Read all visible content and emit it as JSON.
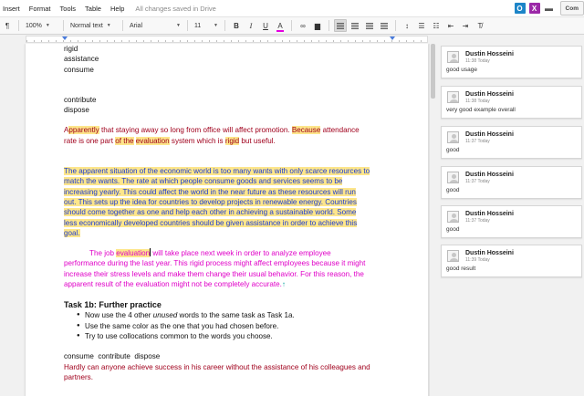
{
  "menu": {
    "items": [
      "Insert",
      "Format",
      "Tools",
      "Table",
      "Help"
    ],
    "saved_status": "All changes saved in Drive",
    "comments_button": "Com"
  },
  "toolbar": {
    "zoom": "100%",
    "style": "Normal text",
    "font": "Arial",
    "size": "11",
    "bold": "B",
    "italic": "I",
    "underline": "U",
    "text_color": "A",
    "text_color_swatch": "#e400e0"
  },
  "document": {
    "word_list_a": [
      "rigid",
      "assistance",
      "consume"
    ],
    "word_list_b": [
      "contribute",
      "dispose"
    ],
    "para1": {
      "s1_pre": "A",
      "s1_hl": "pparently",
      "s1_post": " that staying away so long from office will affect promotion. ",
      "s2_hl": "Because",
      "s2_post": " attendance",
      "s3_pre": "rate is one part ",
      "s3_of": "of the",
      "s3_sp": " ",
      "s3_hl": "evaluation",
      "s3_mid": " system which is ",
      "s3_rigid": "rigid",
      "s3_post": " but useful."
    },
    "para2_lines": [
      "The apparent situation of the economic world is too many wants with only scarce resources to",
      "match the wants. The rate at which people consume goods and services seems to be",
      "increasing yearly. This could affect the world in the near future as these resources will run",
      "out. This sets up the idea for countries to develop projects in renewable energy. Countries",
      "should come together as one and help each other in achieving a sustainable world. Some",
      "less economically developed countries should be given assistance in order to achieve this",
      "goal."
    ],
    "para3": {
      "l1_pre": "The job ",
      "l1_hl": "evaluation",
      "l1_post": " will take place next week in order to analyze employee",
      "lines": [
        "performance during the last year. This rigid process might affect employees because it might",
        "increase their stress levels and make them change their usual behavior. For this reason, the"
      ],
      "l4": "apparent result of the evaluation might not be completely accurate.",
      "caret_mark": "↑"
    },
    "task": {
      "heading": "Task 1b: Further practice",
      "bullet1_pre": "Now use the 4 other ",
      "bullet1_em": "unused",
      "bullet1_post": " words to the same task as Task 1a.",
      "bullet2": "Use the same color as the one that you had chosen before.",
      "bullet3": "Try to use collocations common to the words you choose."
    },
    "footer_words": "consume  contribute  dispose",
    "footer_lines": [
      "Hardly can anyone achieve success in his career without the assistance of his colleagues and",
      "partners."
    ]
  },
  "comments": [
    {
      "author": "Dustin Hosseini",
      "time": "11:38 Today",
      "text": "good usage"
    },
    {
      "author": "Dustin Hosseini",
      "time": "11:38 Today",
      "text": "very good example overall"
    },
    {
      "author": "Dustin Hosseini",
      "time": "11:37 Today",
      "text": "good"
    },
    {
      "author": "Dustin Hosseini",
      "time": "11:37 Today",
      "text": "good"
    },
    {
      "author": "Dustin Hosseini",
      "time": "11:37 Today",
      "text": "good"
    },
    {
      "author": "Dustin Hosseini",
      "time": "11:39 Today",
      "text": "good result"
    }
  ],
  "colors": {
    "highlight": "#fde68b",
    "red_text": "#a0001c",
    "blue_text": "#1b3bd2",
    "magenta_text": "#e000c8"
  }
}
